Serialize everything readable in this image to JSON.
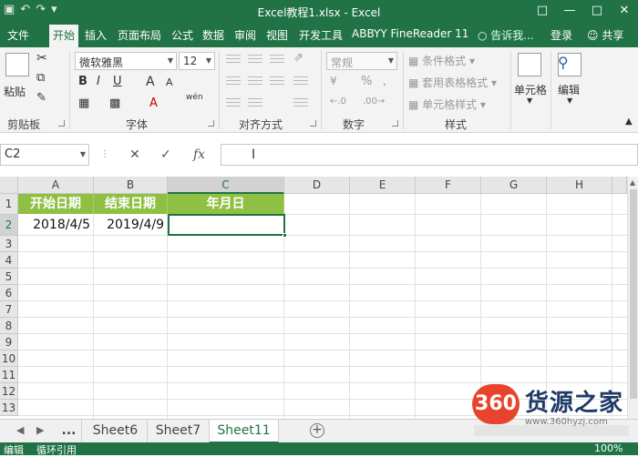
{
  "window": {
    "title": "Excel教程1.xlsx - Excel",
    "qat_icons": [
      "save-icon",
      "undo-icon",
      "redo-icon",
      "customize-icon"
    ]
  },
  "tabs": [
    "文件",
    "开始",
    "插入",
    "页面布局",
    "公式",
    "数据",
    "审阅",
    "视图",
    "开发工具",
    "ABBYY FineReader 11"
  ],
  "active_tab": "开始",
  "tell_me": "告诉我...",
  "login": "登录",
  "share": "共享",
  "ribbon": {
    "clipboard": {
      "label": "剪贴板",
      "paste": "粘贴"
    },
    "font": {
      "label": "字体",
      "name": "微软雅黑",
      "size": "12",
      "bold": "B",
      "italic": "I",
      "underline": "U",
      "grow": "A",
      "shrink": "A",
      "phonetic": "wén"
    },
    "alignment": {
      "label": "对齐方式"
    },
    "number": {
      "label": "数字",
      "format": "常规",
      "percent": "%"
    },
    "styles": {
      "label": "样式",
      "conditional": "条件格式",
      "table": "套用表格格式",
      "cell": "单元格样式"
    },
    "cells": {
      "label": "单元格"
    },
    "editing": {
      "label": "编辑"
    }
  },
  "formula_bar": {
    "name_box": "C2",
    "fx": "fx",
    "cancel": "✕",
    "enter": "✓",
    "content": ""
  },
  "columns": [
    "A",
    "B",
    "C",
    "D",
    "E",
    "F",
    "G",
    "H"
  ],
  "selected_column": "C",
  "rows": [
    "1",
    "2",
    "3",
    "4",
    "5",
    "6",
    "7",
    "8",
    "9",
    "10",
    "11",
    "12",
    "13"
  ],
  "selected_row": "2",
  "table": {
    "headers": [
      "开始日期",
      "结束日期",
      "年月日"
    ],
    "row": [
      "2018/4/5",
      "2019/4/9",
      ""
    ]
  },
  "header_fill_color": "#8fc043",
  "sheets": {
    "more": "...",
    "tabs": [
      "Sheet6",
      "Sheet7",
      "Sheet11"
    ],
    "active": "Sheet11"
  },
  "status": {
    "left1": "编辑",
    "left2": "循环引用",
    "zoom": "100%"
  },
  "watermark": {
    "badge": "360",
    "name": "货源之家",
    "url": "www.360hyzj.com"
  },
  "accent_color": "#217346"
}
